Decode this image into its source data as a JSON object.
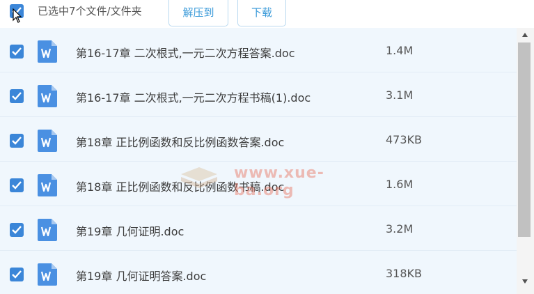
{
  "toolbar": {
    "selected_text": "已选中7个文件/文件夹",
    "extract_label": "解压到",
    "download_label": "下载"
  },
  "files": [
    {
      "name": "第16-17章 二次根式,一元二次方程答案.doc",
      "size": "1.4M",
      "checked": true
    },
    {
      "name": "第16-17章 二次根式,一元二次方程书稿(1).doc",
      "size": "3.1M",
      "checked": true
    },
    {
      "name": "第18章 正比例函数和反比例函数答案.doc",
      "size": "473KB",
      "checked": true
    },
    {
      "name": "第18章 正比例函数和反比例函数书稿.doc",
      "size": "1.6M",
      "checked": true
    },
    {
      "name": "第19章 几何证明.doc",
      "size": "3.2M",
      "checked": true
    },
    {
      "name": "第19章 几何证明答案.doc",
      "size": "318KB",
      "checked": true
    }
  ],
  "watermark": "www.xue-ba.org",
  "colors": {
    "accent": "#3b86d8",
    "button_text": "#3a9ad9",
    "list_bg": "#f0f7fd",
    "word_icon": "#4a90e2"
  }
}
